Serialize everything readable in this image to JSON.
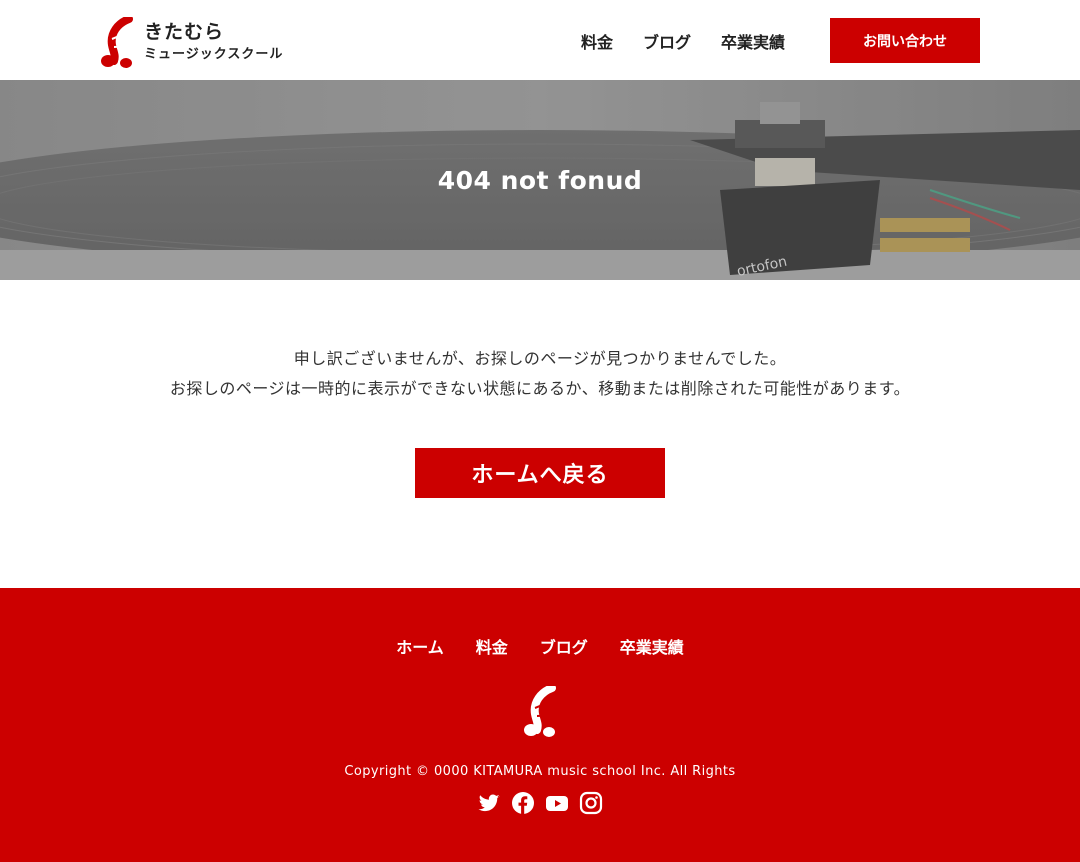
{
  "header": {
    "logo_name": "きたむら",
    "logo_sub": "ミュージックスクール",
    "nav": [
      "料金",
      "ブログ",
      "卒業実績"
    ],
    "contact_label": "お問い合わせ"
  },
  "hero": {
    "title": "404 not fonud",
    "image_text": "ortofon"
  },
  "main": {
    "message_line1": "申し訳ございませんが、お探しのページが見つかりませんでした。",
    "message_line2": "お探しのページは一時的に表示ができない状態にあるか、移動または削除された可能性があります。",
    "home_button_label": "ホームへ戻る"
  },
  "footer": {
    "nav": [
      "ホーム",
      "料金",
      "ブログ",
      "卒業実績"
    ],
    "copyright": "Copyright © 0000 KITAMURA music school Inc. All Rights",
    "social_icons": [
      "twitter-icon",
      "facebook-icon",
      "youtube-icon",
      "instagram-icon"
    ]
  },
  "colors": {
    "accent": "#cc0000",
    "text": "#222222",
    "background": "#ffffff"
  }
}
